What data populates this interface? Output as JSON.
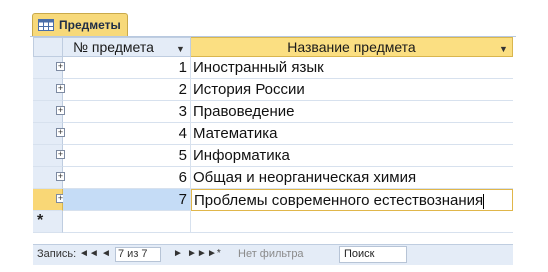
{
  "tab": {
    "title": "Предметы",
    "icon": "table-icon"
  },
  "columns": [
    {
      "label": "№ предмета",
      "sort_icon": "dropdown-arrow-icon"
    },
    {
      "label": "Название предмета",
      "sort_icon": "dropdown-arrow-icon"
    }
  ],
  "rows": [
    {
      "id": "1",
      "name": "Иностранный язык"
    },
    {
      "id": "2",
      "name": "История России"
    },
    {
      "id": "3",
      "name": "Правоведение"
    },
    {
      "id": "4",
      "name": "Математика"
    },
    {
      "id": "5",
      "name": "Информатика"
    },
    {
      "id": "6",
      "name": "Общая и неорганическая химия"
    },
    {
      "id": "7",
      "name": "Проблемы современного естествознания"
    }
  ],
  "new_row_marker": "*",
  "expand_glyph": "+",
  "status": {
    "record_label": "Запись:",
    "first": "◄◄",
    "prev": "◄",
    "position": "7 из 7",
    "next": "►",
    "last": "►►",
    "new": "►*",
    "filter": "Нет фильтра",
    "search": "Поиск"
  },
  "colors": {
    "tab": "#f7d97a",
    "selected_header": "#fbdf82",
    "current_row": "#c5dcf6"
  }
}
